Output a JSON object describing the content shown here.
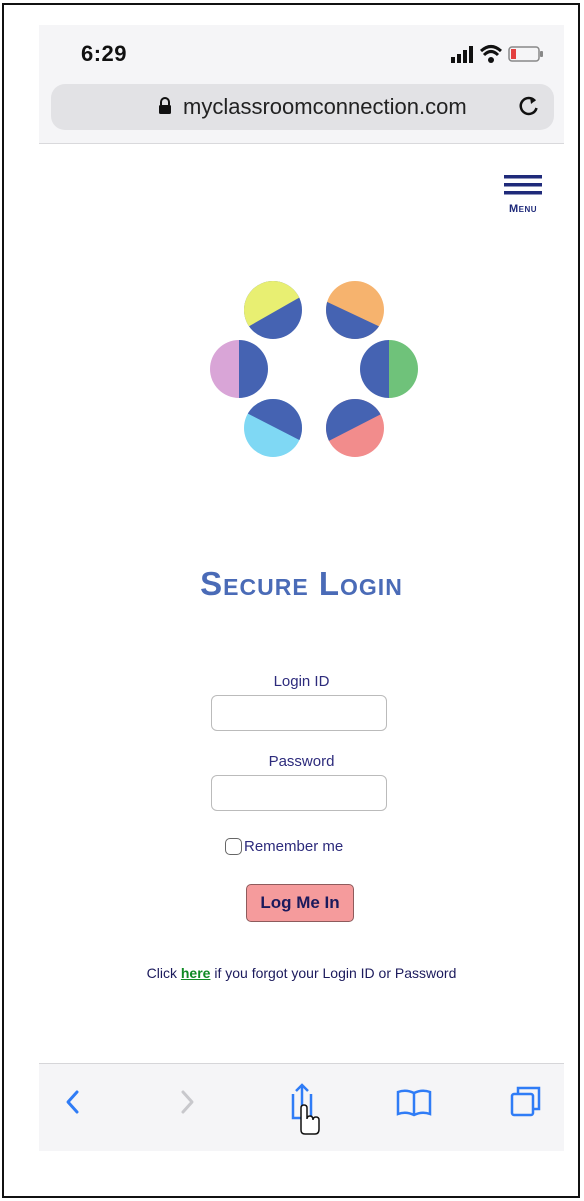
{
  "status_bar": {
    "time": "6:29",
    "icons": [
      "signal-icon",
      "wifi-icon",
      "battery-icon"
    ],
    "battery_color": "#e34040"
  },
  "browser": {
    "url": "myclassroomconnection.com",
    "lock_icon": "lock-icon",
    "reload_icon": "reload-icon"
  },
  "header": {
    "menu_label": "Menu",
    "menu_color": "#1f2a7a"
  },
  "logo": {
    "colors": {
      "dark_blue": "#4563b2",
      "yellow": "#e8ef72",
      "orange": "#f6b36e",
      "green": "#6fc27a",
      "salmon": "#f28c8c",
      "light_blue": "#7fd8f4",
      "lilac": "#d9a5d7"
    }
  },
  "login": {
    "title": "Secure Login",
    "title_color": "#4a6bb7",
    "login_id_label": "Login ID",
    "login_id_value": "",
    "password_label": "Password",
    "password_value": "",
    "remember_label": "Remember me",
    "remember_checked": false,
    "submit_label": "Log Me In",
    "submit_color": "#f59b9c",
    "forgot_prefix": "Click ",
    "forgot_link": "here",
    "forgot_suffix": " if you forgot your Login ID or Password",
    "link_color": "#0f8a24"
  },
  "toolbar": {
    "accent": "#2f7cf6",
    "items": [
      "back-icon",
      "forward-icon",
      "share-icon",
      "bookmarks-icon",
      "tabs-icon"
    ]
  }
}
